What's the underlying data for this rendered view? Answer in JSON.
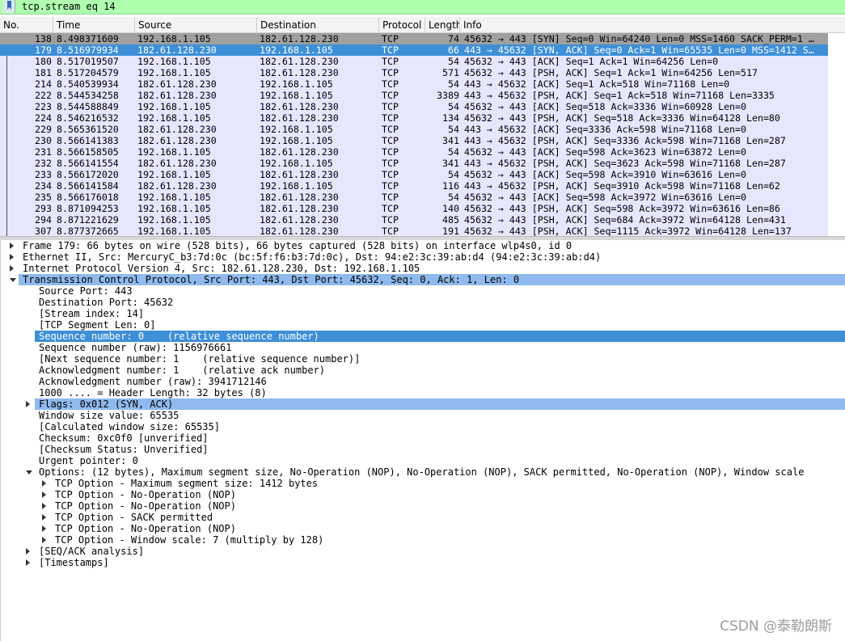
{
  "filter": {
    "text": "tcp.stream eq 14"
  },
  "packet_list": {
    "columns": {
      "no": "No.",
      "time": "Time",
      "source": "Source",
      "destination": "Destination",
      "protocol": "Protocol",
      "length": "Length",
      "info": "Info"
    },
    "rows": [
      {
        "no": "138",
        "time": "8.498371609",
        "source": "192.168.1.105",
        "destination": "182.61.128.230",
        "protocol": "TCP",
        "length": "74",
        "info": "45632 → 443 [SYN] Seq=0 Win=64240 Len=0 MSS=1460 SACK_PERM=1 …"
      },
      {
        "no": "179",
        "time": "8.516979934",
        "source": "182.61.128.230",
        "destination": "192.168.1.105",
        "protocol": "TCP",
        "length": "66",
        "info": "443 → 45632 [SYN, ACK] Seq=0 Ack=1 Win=65535 Len=0 MSS=1412 S…"
      },
      {
        "no": "180",
        "time": "8.517019507",
        "source": "192.168.1.105",
        "destination": "182.61.128.230",
        "protocol": "TCP",
        "length": "54",
        "info": "45632 → 443 [ACK] Seq=1 Ack=1 Win=64256 Len=0"
      },
      {
        "no": "181",
        "time": "8.517204579",
        "source": "192.168.1.105",
        "destination": "182.61.128.230",
        "protocol": "TCP",
        "length": "571",
        "info": "45632 → 443 [PSH, ACK] Seq=1 Ack=1 Win=64256 Len=517"
      },
      {
        "no": "214",
        "time": "8.540539934",
        "source": "182.61.128.230",
        "destination": "192.168.1.105",
        "protocol": "TCP",
        "length": "54",
        "info": "443 → 45632 [ACK] Seq=1 Ack=518 Win=71168 Len=0"
      },
      {
        "no": "222",
        "time": "8.544534258",
        "source": "182.61.128.230",
        "destination": "192.168.1.105",
        "protocol": "TCP",
        "length": "3389",
        "info": "443 → 45632 [PSH, ACK] Seq=1 Ack=518 Win=71168 Len=3335"
      },
      {
        "no": "223",
        "time": "8.544588849",
        "source": "192.168.1.105",
        "destination": "182.61.128.230",
        "protocol": "TCP",
        "length": "54",
        "info": "45632 → 443 [ACK] Seq=518 Ack=3336 Win=60928 Len=0"
      },
      {
        "no": "224",
        "time": "8.546216532",
        "source": "192.168.1.105",
        "destination": "182.61.128.230",
        "protocol": "TCP",
        "length": "134",
        "info": "45632 → 443 [PSH, ACK] Seq=518 Ack=3336 Win=64128 Len=80"
      },
      {
        "no": "229",
        "time": "8.565361520",
        "source": "182.61.128.230",
        "destination": "192.168.1.105",
        "protocol": "TCP",
        "length": "54",
        "info": "443 → 45632 [ACK] Seq=3336 Ack=598 Win=71168 Len=0"
      },
      {
        "no": "230",
        "time": "8.566141383",
        "source": "182.61.128.230",
        "destination": "192.168.1.105",
        "protocol": "TCP",
        "length": "341",
        "info": "443 → 45632 [PSH, ACK] Seq=3336 Ack=598 Win=71168 Len=287"
      },
      {
        "no": "231",
        "time": "8.566158505",
        "source": "192.168.1.105",
        "destination": "182.61.128.230",
        "protocol": "TCP",
        "length": "54",
        "info": "45632 → 443 [ACK] Seq=598 Ack=3623 Win=63872 Len=0"
      },
      {
        "no": "232",
        "time": "8.566141554",
        "source": "182.61.128.230",
        "destination": "192.168.1.105",
        "protocol": "TCP",
        "length": "341",
        "info": "443 → 45632 [PSH, ACK] Seq=3623 Ack=598 Win=71168 Len=287"
      },
      {
        "no": "233",
        "time": "8.566172020",
        "source": "192.168.1.105",
        "destination": "182.61.128.230",
        "protocol": "TCP",
        "length": "54",
        "info": "45632 → 443 [ACK] Seq=598 Ack=3910 Win=63616 Len=0"
      },
      {
        "no": "234",
        "time": "8.566141584",
        "source": "182.61.128.230",
        "destination": "192.168.1.105",
        "protocol": "TCP",
        "length": "116",
        "info": "443 → 45632 [PSH, ACK] Seq=3910 Ack=598 Win=71168 Len=62"
      },
      {
        "no": "235",
        "time": "8.566176018",
        "source": "192.168.1.105",
        "destination": "182.61.128.230",
        "protocol": "TCP",
        "length": "54",
        "info": "45632 → 443 [ACK] Seq=598 Ack=3972 Win=63616 Len=0"
      },
      {
        "no": "293",
        "time": "8.871094253",
        "source": "192.168.1.105",
        "destination": "182.61.128.230",
        "protocol": "TCP",
        "length": "140",
        "info": "45632 → 443 [PSH, ACK] Seq=598 Ack=3972 Win=63616 Len=86"
      },
      {
        "no": "294",
        "time": "8.871221629",
        "source": "192.168.1.105",
        "destination": "182.61.128.230",
        "protocol": "TCP",
        "length": "485",
        "info": "45632 → 443 [PSH, ACK] Seq=684 Ack=3972 Win=64128 Len=431"
      },
      {
        "no": "307",
        "time": "8.877372665",
        "source": "192.168.1.105",
        "destination": "182.61.128.230",
        "protocol": "TCP",
        "length": "191",
        "info": "45632 → 443 [PSH, ACK] Seq=1115 Ack=3972 Win=64128 Len=137"
      }
    ]
  },
  "detail_tree": [
    {
      "text": "Frame 179: 66 bytes on wire (528 bits), 66 bytes captured (528 bits) on interface wlp4s0, id 0",
      "level": 0,
      "arrow": "right",
      "state": ""
    },
    {
      "text": "Ethernet II, Src: MercuryC_b3:7d:0c (bc:5f:f6:b3:7d:0c), Dst: 94:e2:3c:39:ab:d4 (94:e2:3c:39:ab:d4)",
      "level": 0,
      "arrow": "right",
      "state": ""
    },
    {
      "text": "Internet Protocol Version 4, Src: 182.61.128.230, Dst: 192.168.1.105",
      "level": 0,
      "arrow": "right",
      "state": ""
    },
    {
      "text": "Transmission Control Protocol, Src Port: 443, Dst Port: 45632, Seq: 0, Ack: 1, Len: 0",
      "level": 0,
      "arrow": "down",
      "state": "hl"
    },
    {
      "text": "Source Port: 443",
      "level": 1,
      "arrow": "",
      "state": ""
    },
    {
      "text": "Destination Port: 45632",
      "level": 1,
      "arrow": "",
      "state": ""
    },
    {
      "text": "[Stream index: 14]",
      "level": 1,
      "arrow": "",
      "state": ""
    },
    {
      "text": "[TCP Segment Len: 0]",
      "level": 1,
      "arrow": "",
      "state": ""
    },
    {
      "text": "Sequence number: 0    (relative sequence number)",
      "level": 1,
      "arrow": "",
      "state": "sel"
    },
    {
      "text": "Sequence number (raw): 1156976661",
      "level": 1,
      "arrow": "",
      "state": ""
    },
    {
      "text": "[Next sequence number: 1    (relative sequence number)]",
      "level": 1,
      "arrow": "",
      "state": ""
    },
    {
      "text": "Acknowledgment number: 1    (relative ack number)",
      "level": 1,
      "arrow": "",
      "state": ""
    },
    {
      "text": "Acknowledgment number (raw): 3941712146",
      "level": 1,
      "arrow": "",
      "state": ""
    },
    {
      "text": "1000 .... = Header Length: 32 bytes (8)",
      "level": 1,
      "arrow": "",
      "state": ""
    },
    {
      "text": "Flags: 0x012 (SYN, ACK)",
      "level": 1,
      "arrow": "right",
      "state": "hl"
    },
    {
      "text": "Window size value: 65535",
      "level": 1,
      "arrow": "",
      "state": ""
    },
    {
      "text": "[Calculated window size: 65535]",
      "level": 1,
      "arrow": "",
      "state": ""
    },
    {
      "text": "Checksum: 0xc0f0 [unverified]",
      "level": 1,
      "arrow": "",
      "state": ""
    },
    {
      "text": "[Checksum Status: Unverified]",
      "level": 1,
      "arrow": "",
      "state": ""
    },
    {
      "text": "Urgent pointer: 0",
      "level": 1,
      "arrow": "",
      "state": ""
    },
    {
      "text": "Options: (12 bytes), Maximum segment size, No-Operation (NOP), No-Operation (NOP), SACK permitted, No-Operation (NOP), Window scale",
      "level": 1,
      "arrow": "down",
      "state": ""
    },
    {
      "text": "TCP Option - Maximum segment size: 1412 bytes",
      "level": 2,
      "arrow": "right",
      "state": ""
    },
    {
      "text": "TCP Option - No-Operation (NOP)",
      "level": 2,
      "arrow": "right",
      "state": ""
    },
    {
      "text": "TCP Option - No-Operation (NOP)",
      "level": 2,
      "arrow": "right",
      "state": ""
    },
    {
      "text": "TCP Option - SACK permitted",
      "level": 2,
      "arrow": "right",
      "state": ""
    },
    {
      "text": "TCP Option - No-Operation (NOP)",
      "level": 2,
      "arrow": "right",
      "state": ""
    },
    {
      "text": "TCP Option - Window scale: 7 (multiply by 128)",
      "level": 2,
      "arrow": "right",
      "state": ""
    },
    {
      "text": "[SEQ/ACK analysis]",
      "level": 1,
      "arrow": "right",
      "state": ""
    },
    {
      "text": "[Timestamps]",
      "level": 1,
      "arrow": "right",
      "state": ""
    }
  ],
  "watermark": "CSDN @泰勒朗斯",
  "colors": {
    "filter_bg": "#afffaf",
    "row_bg": "#e7e6ff",
    "selected": "#3d8fd7",
    "highlight": "#8fbaed"
  }
}
